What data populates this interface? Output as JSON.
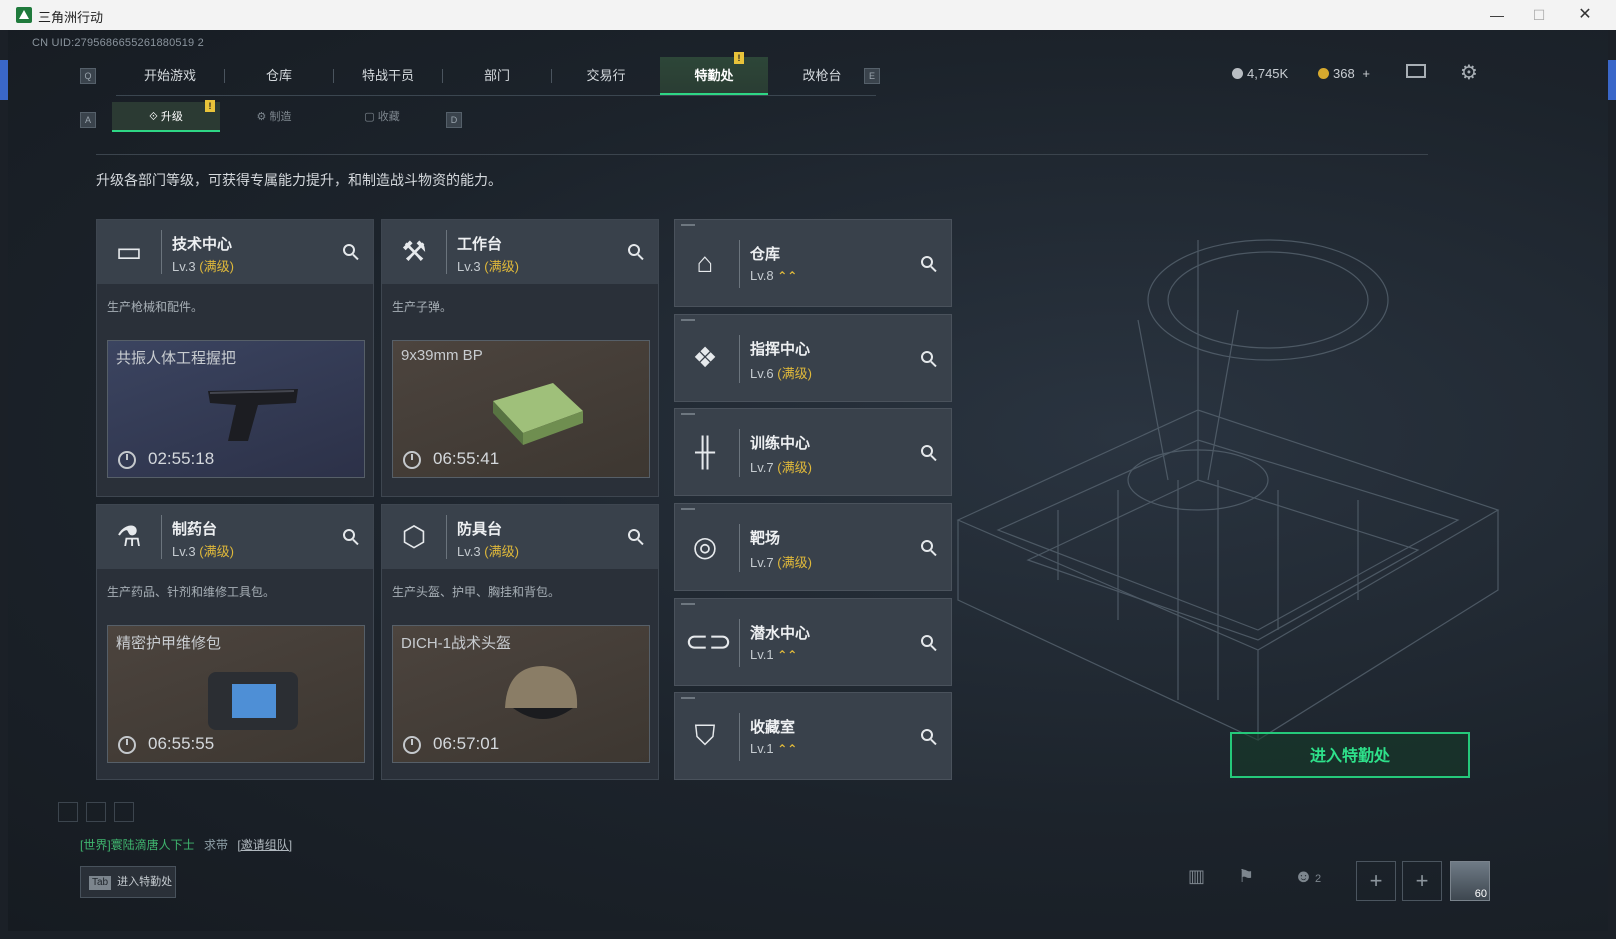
{
  "window": {
    "title": "三角洲行动"
  },
  "uid": "CN UID:2795686655261880519 2",
  "nav": {
    "key_left": "Q",
    "key_right": "E",
    "tabs": [
      "开始游戏",
      "仓库",
      "特战干员",
      "部门",
      "交易行",
      "特勤处",
      "改枪台"
    ],
    "active": "特勤处",
    "badge": "!"
  },
  "currency": {
    "silver": "4,745K",
    "gold": "368",
    "gold_add": "+",
    "silver_color": "#c9ced3",
    "gold_color": "#e0b93a"
  },
  "subnav": {
    "key_left": "A",
    "key_right": "D",
    "tabs": [
      "升级",
      "制造",
      "收藏"
    ],
    "active": "升级",
    "badge": "!"
  },
  "intro": "升级各部门等级，可获得专属能力提升，和制造战斗物资的能力。",
  "dept_cards": [
    {
      "name": "技术中心",
      "level": "Lv.3",
      "max": "(满级)",
      "desc": "生产枪械和配件。",
      "product": "共振人体工程握把",
      "timer": "02:55:18",
      "icon": "monitor-icon"
    },
    {
      "name": "工作台",
      "level": "Lv.3",
      "max": "(满级)",
      "desc": "生产子弹。",
      "product": "9x39mm BP",
      "timer": "06:55:41",
      "icon": "hammer-wrench-icon"
    },
    {
      "name": "制药台",
      "level": "Lv.3",
      "max": "(满级)",
      "desc": "生产药品、针剂和维修工具包。",
      "product": "精密护甲维修包",
      "timer": "06:55:55",
      "icon": "microscope-icon"
    },
    {
      "name": "防具台",
      "level": "Lv.3",
      "max": "(满级)",
      "desc": "生产头盔、护甲、胸挂和背包。",
      "product": "DICH-1战术头盔",
      "timer": "06:57:01",
      "icon": "armor-blocks-icon"
    }
  ],
  "side_cards": [
    {
      "name": "仓库",
      "level": "Lv.8",
      "max": "",
      "upgrade": "⌃⌃",
      "icon": "warehouse-icon"
    },
    {
      "name": "指挥中心",
      "level": "Lv.6",
      "max": "(满级)",
      "upgrade": "",
      "icon": "command-icon"
    },
    {
      "name": "训练中心",
      "level": "Lv.7",
      "max": "(满级)",
      "upgrade": "",
      "icon": "dumbbell-icon"
    },
    {
      "name": "靶场",
      "level": "Lv.7",
      "max": "(满级)",
      "upgrade": "",
      "icon": "target-icon"
    },
    {
      "name": "潜水中心",
      "level": "Lv.1",
      "max": "",
      "upgrade": "⌃⌃",
      "icon": "diving-goggles-icon"
    },
    {
      "name": "收藏室",
      "level": "Lv.1",
      "max": "",
      "upgrade": "⌃⌃",
      "icon": "collection-icon"
    }
  ],
  "enter_button": "进入特勤处",
  "chat": {
    "channel": "[世界]",
    "user": "寰陆滴唐人下士",
    "text": "求带",
    "link": "[邀请组队]"
  },
  "tab_hint": {
    "key": "Tab",
    "label": "进入特勤处"
  },
  "bottom": {
    "friends_count": "2",
    "avatar_level": "60"
  }
}
